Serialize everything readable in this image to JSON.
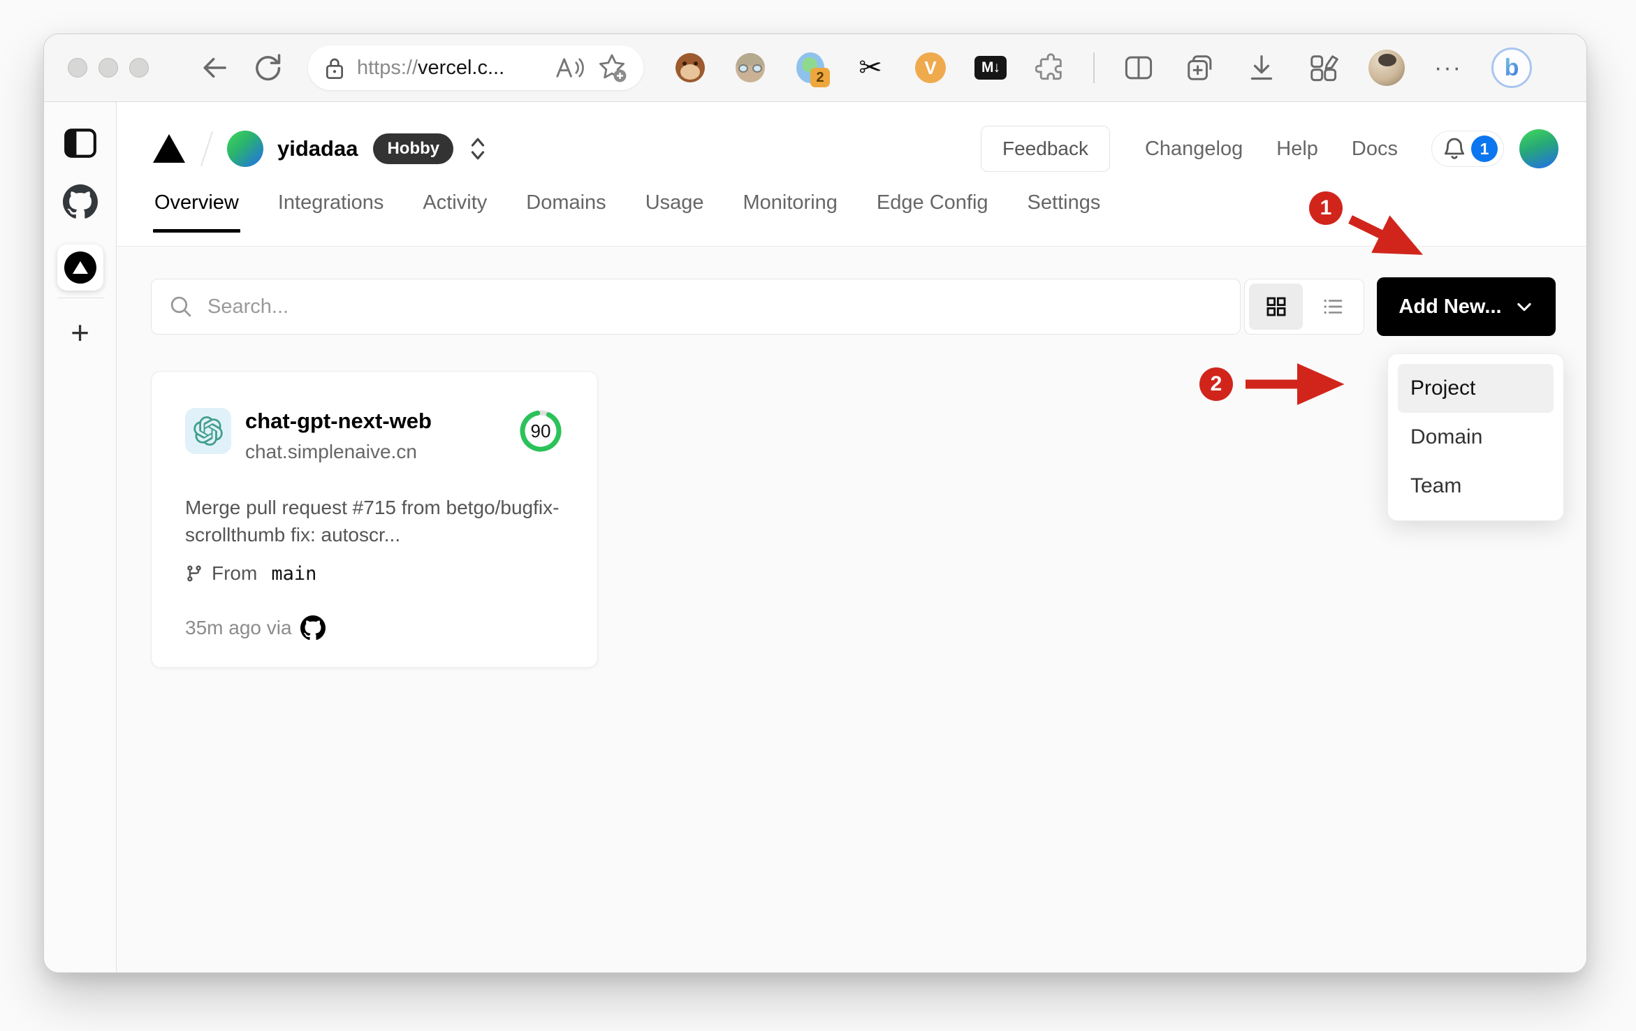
{
  "browser": {
    "address_scheme": "https://",
    "address_host": "vercel.c...",
    "translate_badge": "2",
    "markdown_icon_label": "M↓",
    "v_icon_label": "V",
    "dots_label": "···",
    "bing_label": "b"
  },
  "vercel_header": {
    "team_name": "yidadaa",
    "plan_badge": "Hobby",
    "feedback_label": "Feedback",
    "nav_links": [
      "Changelog",
      "Help",
      "Docs"
    ],
    "notification_count": "1"
  },
  "tabs": {
    "items": [
      "Overview",
      "Integrations",
      "Activity",
      "Domains",
      "Usage",
      "Monitoring",
      "Edge Config",
      "Settings"
    ],
    "active": "Overview"
  },
  "toolbar": {
    "search_placeholder": "Search...",
    "add_new_label": "Add New..."
  },
  "dropdown": {
    "items": [
      "Project",
      "Domain",
      "Team"
    ],
    "highlighted": "Project"
  },
  "project_card": {
    "name": "chat-gpt-next-web",
    "domain": "chat.simplenaive.cn",
    "score": "90",
    "commit_message": "Merge pull request #715 from betgo/bugfix-scrollthumb fix: autoscr...",
    "from_label": "From",
    "branch": "main",
    "deployed": "35m ago via"
  },
  "annotations": {
    "step_1": "1",
    "step_2": "2",
    "arrow_color": "#d1251c"
  },
  "colors": {
    "score_green": "#2cc25a",
    "add_new_bg": "#000000",
    "notification_blue": "#0b76ef",
    "hobby_badge_bg": "#333333",
    "avatar_gradient": [
      "#3fd35c",
      "#2272e2"
    ]
  }
}
